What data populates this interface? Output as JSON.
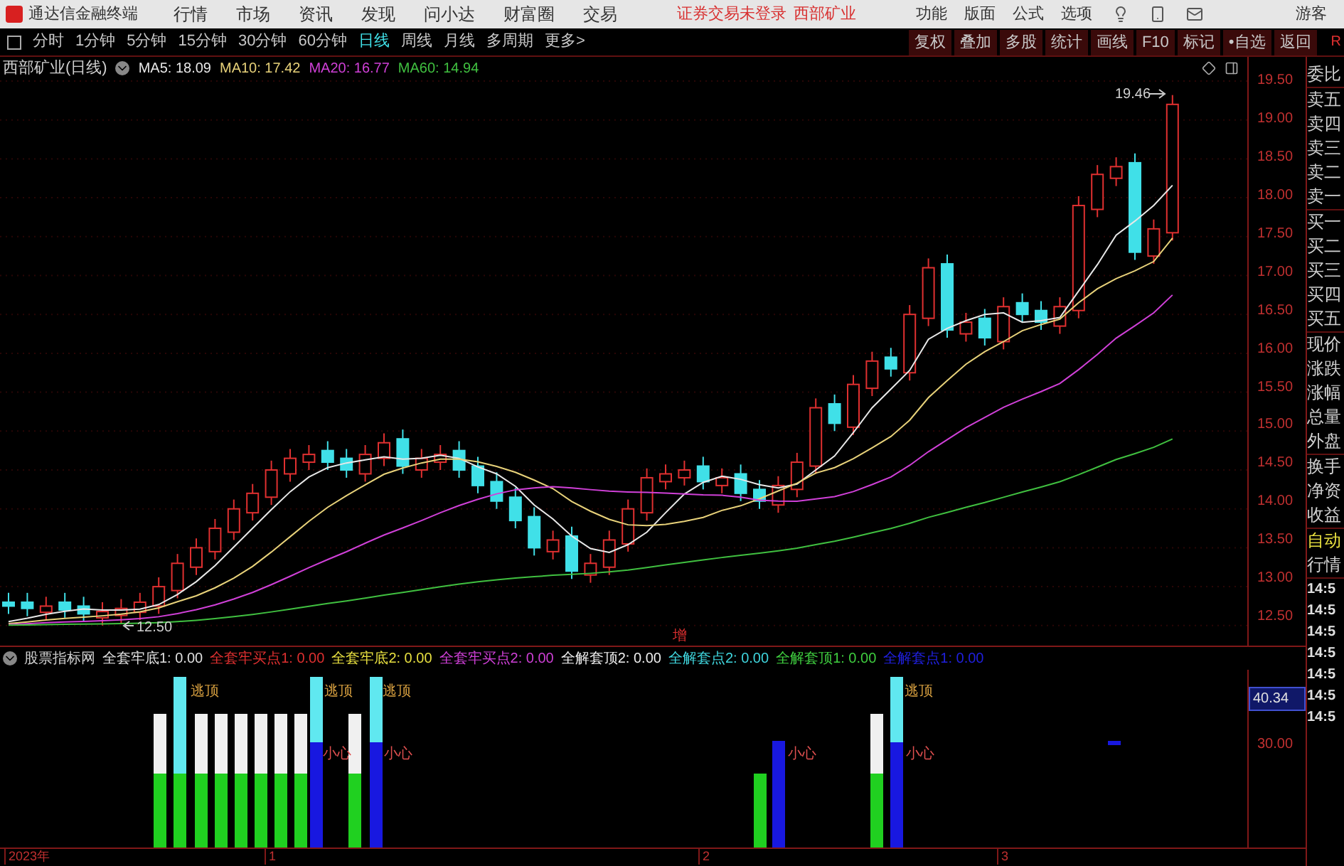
{
  "app": {
    "title": "通达信金融终端",
    "menu": [
      "行情",
      "市场",
      "资讯",
      "发现",
      "问小达",
      "财富圈",
      "交易"
    ],
    "login_status": "证券交易未登录",
    "stock": "西部矿业",
    "right_menu": [
      "功能",
      "版面",
      "公式",
      "选项"
    ],
    "user": "游客"
  },
  "periods": [
    {
      "label": "分时",
      "selected": false
    },
    {
      "label": "1分钟",
      "selected": false
    },
    {
      "label": "5分钟",
      "selected": false
    },
    {
      "label": "15分钟",
      "selected": false
    },
    {
      "label": "30分钟",
      "selected": false
    },
    {
      "label": "60分钟",
      "selected": false
    },
    {
      "label": "日线",
      "selected": true
    },
    {
      "label": "周线",
      "selected": false
    },
    {
      "label": "月线",
      "selected": false
    },
    {
      "label": "多周期",
      "selected": false
    },
    {
      "label": "更多>",
      "selected": false
    }
  ],
  "tools": [
    "复权",
    "叠加",
    "多股",
    "统计",
    "画线",
    "F10",
    "标记",
    "•自选",
    "返回"
  ],
  "corner_mark": "R",
  "chart": {
    "title": "西部矿业(日线)",
    "ma": [
      {
        "label": "MA5: 18.09",
        "color": "#e8e8e8"
      },
      {
        "label": "MA10: 17.42",
        "color": "#e8d27a"
      },
      {
        "label": "MA20: 16.77",
        "color": "#d040d8"
      },
      {
        "label": "MA60: 14.94",
        "color": "#40c040"
      }
    ],
    "y_labels": [
      "19.50",
      "19.00",
      "18.50",
      "18.00",
      "17.50",
      "17.00",
      "16.50",
      "16.00",
      "15.50",
      "15.00",
      "14.50",
      "14.00",
      "13.50",
      "13.00",
      "12.50"
    ],
    "high_label": "19.46",
    "low_label": "12.50",
    "marker": "增"
  },
  "indicator": {
    "name": "股票指标网",
    "lines": [
      {
        "label": "全套牢底1: 0.00",
        "color": "#e0e0e0"
      },
      {
        "label": "全套牢买点1: 0.00",
        "color": "#e03030"
      },
      {
        "label": "全套牢底2: 0.00",
        "color": "#e8e040"
      },
      {
        "label": "全套牢买点2: 0.00",
        "color": "#d040d8"
      },
      {
        "label": "全解套顶2: 0.00",
        "color": "#f0f0f0"
      },
      {
        "label": "全解套点2: 0.00",
        "color": "#40d8e0"
      },
      {
        "label": "全解套顶1: 0.00",
        "color": "#40d040"
      },
      {
        "label": "全解套点1: 0.00",
        "color": "#2020e0"
      }
    ],
    "tags": [
      {
        "text": "逃顶",
        "kind": "top"
      },
      {
        "text": "逃顶",
        "kind": "top"
      },
      {
        "text": "逃顶",
        "kind": "top"
      },
      {
        "text": "逃顶",
        "kind": "top"
      },
      {
        "text": "小心",
        "kind": "caution"
      },
      {
        "text": "小心",
        "kind": "caution"
      },
      {
        "text": "小心",
        "kind": "caution"
      },
      {
        "text": "小心",
        "kind": "caution"
      }
    ],
    "axis": [
      {
        "label": "40.34",
        "selected": true
      },
      {
        "label": "30.00",
        "selected": false
      }
    ]
  },
  "x_labels": [
    "2023年",
    "1",
    "2",
    "3"
  ],
  "side": {
    "items": [
      "委比",
      "卖五",
      "卖四",
      "卖三",
      "卖二",
      "卖一",
      "买一",
      "买二",
      "买三",
      "买四",
      "买五",
      "现价",
      "涨跌",
      "涨幅",
      "总量",
      "外盘",
      "换手",
      "净资",
      "收益"
    ],
    "auto": "自动",
    "quotes": "行情",
    "times": [
      "14:5",
      "14:5",
      "14:5",
      "14:5",
      "14:5",
      "14:5",
      "14:5"
    ]
  }
}
